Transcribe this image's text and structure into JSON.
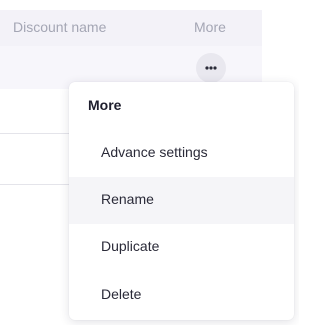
{
  "table": {
    "columns": {
      "discount_name": "Discount name",
      "more": "More"
    },
    "more_button_icon": "ellipsis-horizontal-icon"
  },
  "menu": {
    "title": "More",
    "items": [
      {
        "label": "Advance settings"
      },
      {
        "label": "Rename",
        "hovered": true
      },
      {
        "label": "Duplicate"
      },
      {
        "label": "Delete"
      }
    ]
  },
  "colors": {
    "header_bg": "#f3f2f8",
    "header_text": "#a4a6b4",
    "selected_row_bg": "#f7f6fb",
    "menu_hover_bg": "#f5f5f8",
    "more_button_bg": "#e9e8ef"
  }
}
